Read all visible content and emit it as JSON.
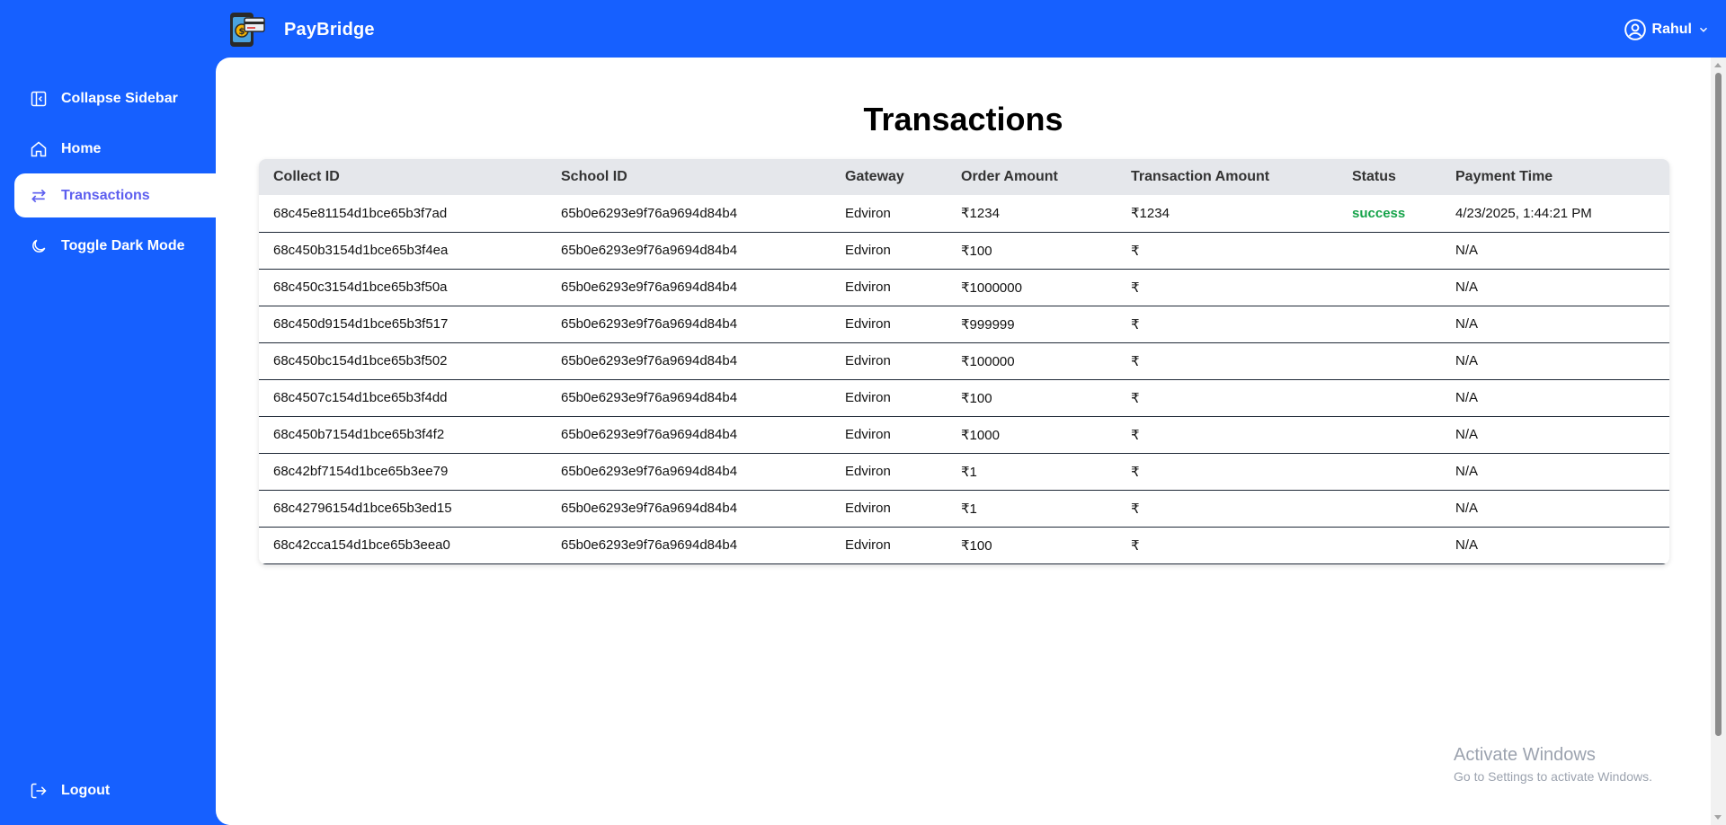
{
  "app": {
    "brand_name": "PayBridge",
    "user_name": "Rahul",
    "accent_color": "#1660ff",
    "active_color": "#5d5fef",
    "success_color": "#16a34a"
  },
  "sidebar": {
    "items": [
      {
        "label": "Collapse Sidebar",
        "icon": "collapse-sidebar-icon"
      },
      {
        "label": "Home",
        "icon": "home-icon"
      },
      {
        "label": "Transactions",
        "icon": "transfer-arrows-icon",
        "active": true
      },
      {
        "label": "Toggle Dark Mode",
        "icon": "moon-icon"
      }
    ],
    "logout_label": "Logout"
  },
  "main": {
    "title": "Transactions",
    "table": {
      "headers": [
        "Collect ID",
        "School ID",
        "Gateway",
        "Order Amount",
        "Transaction Amount",
        "Status",
        "Payment Time"
      ],
      "rows": [
        [
          "68c45e81154d1bce65b3f7ad",
          "65b0e6293e9f76a9694d84b4",
          "Edviron",
          "₹1234",
          "₹1234",
          "success",
          "4/23/2025, 1:44:21 PM"
        ],
        [
          "68c450b3154d1bce65b3f4ea",
          "65b0e6293e9f76a9694d84b4",
          "Edviron",
          "₹100",
          "₹",
          "",
          "N/A"
        ],
        [
          "68c450c3154d1bce65b3f50a",
          "65b0e6293e9f76a9694d84b4",
          "Edviron",
          "₹1000000",
          "₹",
          "",
          "N/A"
        ],
        [
          "68c450d9154d1bce65b3f517",
          "65b0e6293e9f76a9694d84b4",
          "Edviron",
          "₹999999",
          "₹",
          "",
          "N/A"
        ],
        [
          "68c450bc154d1bce65b3f502",
          "65b0e6293e9f76a9694d84b4",
          "Edviron",
          "₹100000",
          "₹",
          "",
          "N/A"
        ],
        [
          "68c4507c154d1bce65b3f4dd",
          "65b0e6293e9f76a9694d84b4",
          "Edviron",
          "₹100",
          "₹",
          "",
          "N/A"
        ],
        [
          "68c450b7154d1bce65b3f4f2",
          "65b0e6293e9f76a9694d84b4",
          "Edviron",
          "₹1000",
          "₹",
          "",
          "N/A"
        ],
        [
          "68c42bf7154d1bce65b3ee79",
          "65b0e6293e9f76a9694d84b4",
          "Edviron",
          "₹1",
          "₹",
          "",
          "N/A"
        ],
        [
          "68c42796154d1bce65b3ed15",
          "65b0e6293e9f76a9694d84b4",
          "Edviron",
          "₹1",
          "₹",
          "",
          "N/A"
        ],
        [
          "68c42cca154d1bce65b3eea0",
          "65b0e6293e9f76a9694d84b4",
          "Edviron",
          "₹100",
          "₹",
          "",
          "N/A"
        ]
      ]
    }
  },
  "watermark": {
    "line1": "Activate Windows",
    "line2": "Go to Settings to activate Windows."
  }
}
